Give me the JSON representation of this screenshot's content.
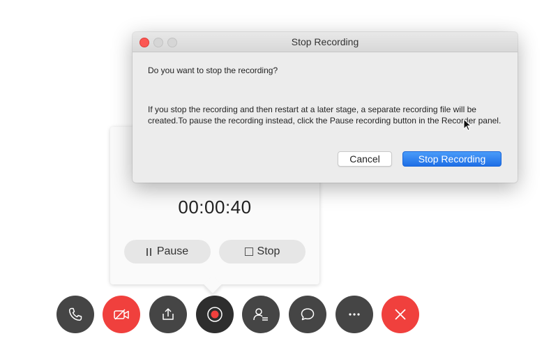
{
  "dialog": {
    "title": "Stop Recording",
    "question": "Do you want to stop the recording?",
    "explanation": "If you stop the recording and then restart at a later stage, a separate recording file will be created.To pause the recording instead, click the Pause recording button in the Recorder panel.",
    "cancel_label": "Cancel",
    "confirm_label": "Stop Recording"
  },
  "recorder": {
    "timer": "00:00:40",
    "pause_label": "Pause",
    "stop_label": "Stop"
  },
  "control_bar": {
    "buttons": [
      {
        "icon": "phone-icon"
      },
      {
        "icon": "video-off-icon",
        "color": "#f0403d"
      },
      {
        "icon": "share-icon"
      },
      {
        "icon": "record-icon"
      },
      {
        "icon": "participants-icon"
      },
      {
        "icon": "chat-icon"
      },
      {
        "icon": "more-icon"
      },
      {
        "icon": "close-icon",
        "color": "#f0403d"
      }
    ]
  },
  "colors": {
    "accent_blue": "#1e6fe6",
    "end_red": "#f0403d",
    "control_dark": "#454545"
  }
}
